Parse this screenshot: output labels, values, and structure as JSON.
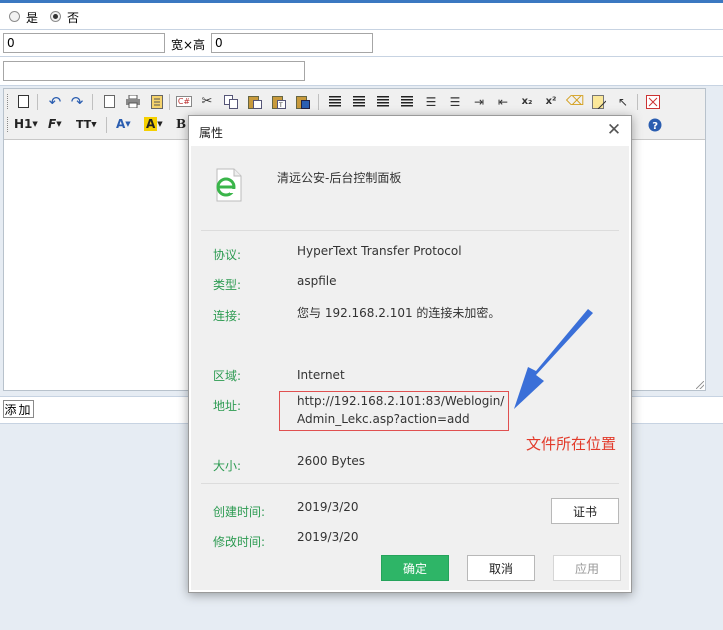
{
  "form": {
    "radio_yes": "是",
    "radio_no": "否",
    "width_value": "0",
    "size_separator": "宽×高",
    "height_value": "0",
    "text_value": ""
  },
  "toolbar": {
    "heading_label": "H1",
    "font_label": "F",
    "size_label": "TT",
    "font_color_label": "A",
    "bg_color_label": "A",
    "bold_label": "B",
    "subscript_label": "x₂",
    "superscript_label": "x²"
  },
  "add_button_label": "添加",
  "dialog": {
    "title": "属性",
    "page_name": "清远公安-后台控制面板",
    "protocol_label": "协议:",
    "protocol_value": "HyperText Transfer Protocol",
    "type_label": "类型:",
    "type_value": "aspfile",
    "connection_label": "连接:",
    "connection_value": "您与 192.168.2.101 的连接未加密。",
    "zone_label": "区域:",
    "zone_value": "Internet",
    "address_label": "地址:",
    "address_line1": "http://192.168.2.101:83/Weblogin/",
    "address_line2": "Admin_Lekc.asp?action=add",
    "size_label": "大小:",
    "size_value": "2600 Bytes",
    "created_label": "创建时间:",
    "created_value": "2019/3/20",
    "modified_label": "修改时间:",
    "modified_value": "2019/3/20",
    "cert_button": "证书",
    "ok_button": "确定",
    "cancel_button": "取消",
    "apply_button": "应用"
  },
  "annotation_text": "文件所在位置",
  "colors": {
    "accent_green": "#2eb567",
    "label_green": "#2d9b52",
    "annotation_red": "#e23a2a",
    "arrow_blue": "#3a6fd8",
    "top_bar_blue": "#3b78c1"
  }
}
